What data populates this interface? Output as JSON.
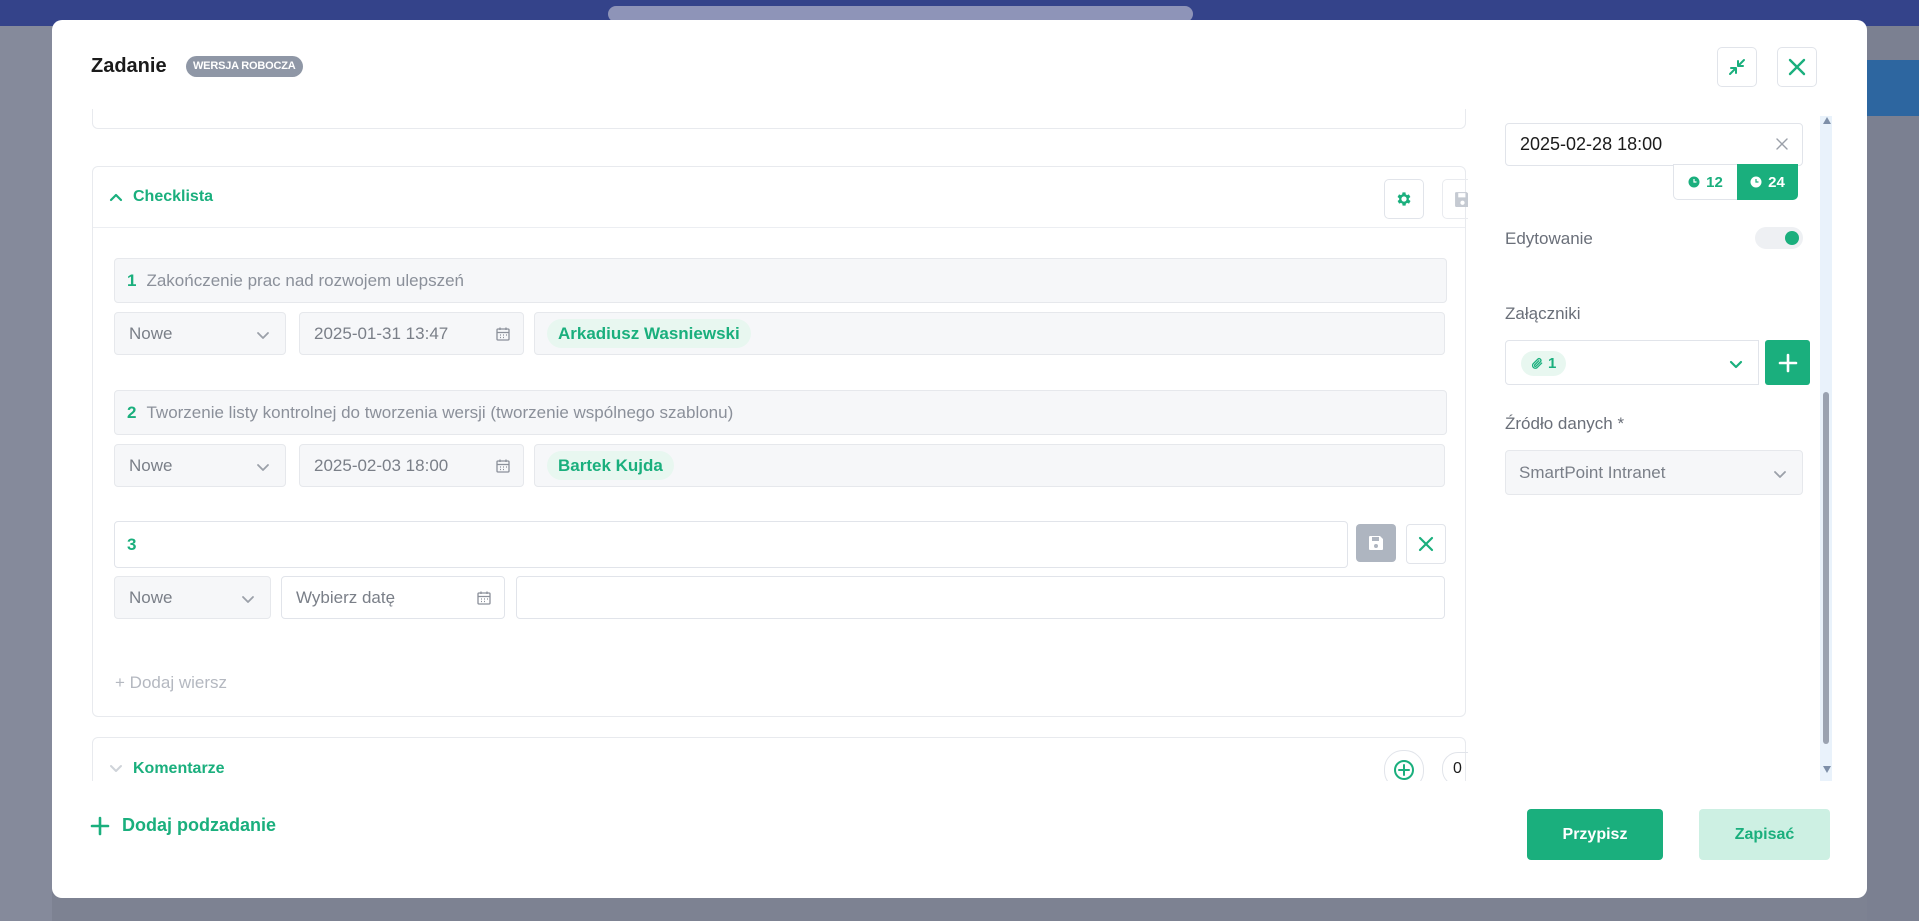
{
  "modal": {
    "title": "Zadanie",
    "badge": "WERSJA ROBOCZA"
  },
  "checklist": {
    "title": "Checklista",
    "items": [
      {
        "number": "1",
        "title": "Zakończenie prac nad rozwojem ulepszeń",
        "status": "Nowe",
        "date": "2025-01-31 13:47",
        "assignee": "Arkadiusz Wasniewski"
      },
      {
        "number": "2",
        "title": "Tworzenie listy kontrolnej do tworzenia wersji (tworzenie wspólnego szablonu)",
        "status": "Nowe",
        "date": "2025-02-03 18:00",
        "assignee": "Bartek Kujda"
      }
    ],
    "new_item": {
      "number": "3",
      "status": "Nowe",
      "date_placeholder": "Wybierz datę"
    },
    "add_row_label": "Dodaj wiersz"
  },
  "comments": {
    "title": "Komentarze",
    "count": "0"
  },
  "right": {
    "deadline": "2025-02-28 18:00",
    "clock_12": "12",
    "clock_24": "24",
    "clock_selected": "24",
    "edit_label": "Edytowanie",
    "edit_enabled": true,
    "attachments_label": "Załączniki",
    "attachments_count": "1",
    "source_label": "Źródło danych *",
    "source_value": "SmartPoint Intranet"
  },
  "footer": {
    "add_subtask": "Dodaj podzadanie",
    "assign": "Przypisz",
    "save": "Zapisać"
  },
  "colors": {
    "accent": "#1aaf7d",
    "accent_light": "#e8f7f0",
    "badge": "#8f97a6",
    "overlay": "#7b8091"
  }
}
